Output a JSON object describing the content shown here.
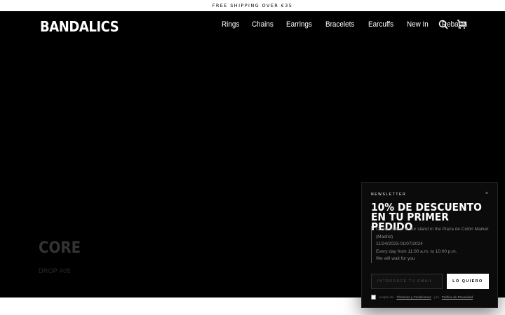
{
  "announcement": "FREE SHIPPING OVER €35",
  "logo": "BANDALICS",
  "nav": {
    "items": [
      "Rings",
      "Chains",
      "Earrings",
      "Bracelets",
      "Earcuffs",
      "New In",
      "Rebajas"
    ]
  },
  "icons": {
    "search": "search-icon",
    "cart": "cart-icon"
  },
  "hero": {
    "title": "CORE",
    "subtitle": "DROP #05"
  },
  "newsletter": {
    "eyebrow": "NEWSLETTER",
    "close": "×",
    "heading_line1": "10% DE DESCUENTO",
    "heading_line2": "EN TU PRIMER PEDIDO",
    "body": [
      "Come visit us at our stand in the Plaza de Colón Market (Madrid)",
      "11/24/2023-01/07/2024",
      "Every day from 11:00 a.m. to 10:00 p.m.",
      "We will wait for you"
    ],
    "email_placeholder": "INTRODUCE TU EMAIL",
    "submit_label": "LO QUIERO",
    "consent_prefix": "Acepto los",
    "terms_label": "Términos y Condiciones",
    "consent_mid": "y la",
    "privacy_label": "Política de Privacidad"
  },
  "colors": {
    "background": "#000000",
    "text": "#ffffff",
    "accent": "#ffffff"
  }
}
